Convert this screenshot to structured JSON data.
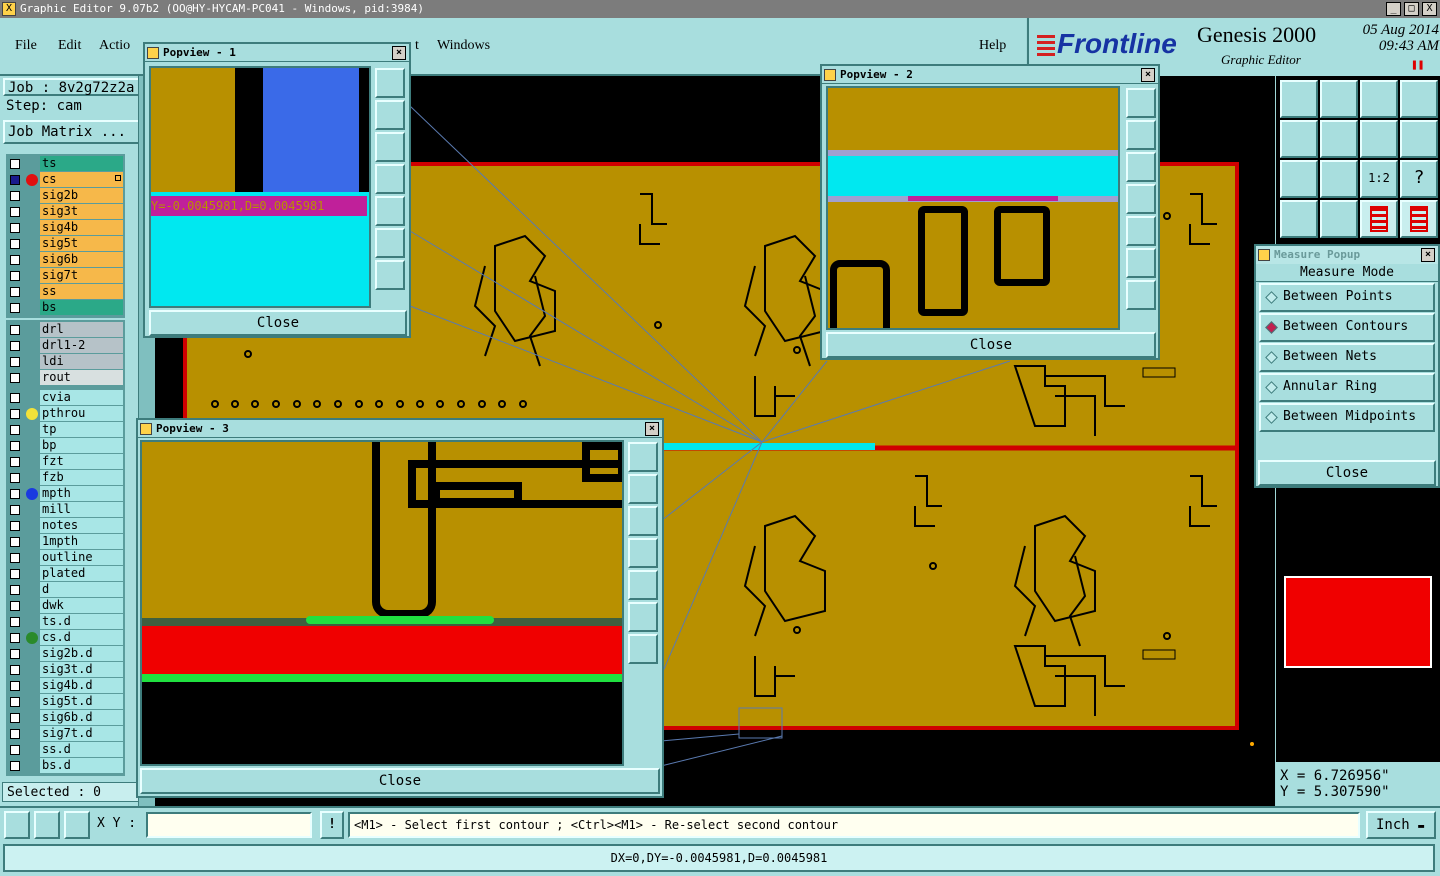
{
  "window": {
    "title": "Graphic Editor 9.07b2 (OO@HY-HYCAM-PC041 - Windows, pid:3984)",
    "controls": [
      "_",
      "□",
      "X"
    ]
  },
  "menu": {
    "file": "File",
    "edit": "Edit",
    "action": "Actio",
    "hidden_tail": "t",
    "windows": "Windows",
    "help": "Help"
  },
  "brand": {
    "logo": "Frontline",
    "product": "Genesis 2000",
    "subtitle": "Graphic Editor",
    "date": "05 Aug 2014",
    "time": "09:43 AM"
  },
  "job": {
    "job_label": "Job : 8v2g72z2a",
    "step_label": "Step: cam",
    "matrix_button": "Job Matrix ..."
  },
  "layers_group1": [
    {
      "name": "ts",
      "color": "teal",
      "dot": ""
    },
    {
      "name": "cs",
      "color": "orange",
      "dot": "#e01010",
      "active": true
    },
    {
      "name": "sig2b",
      "color": "orange",
      "dot": ""
    },
    {
      "name": "sig3t",
      "color": "orange",
      "dot": ""
    },
    {
      "name": "sig4b",
      "color": "orange",
      "dot": ""
    },
    {
      "name": "sig5t",
      "color": "orange",
      "dot": ""
    },
    {
      "name": "sig6b",
      "color": "orange",
      "dot": ""
    },
    {
      "name": "sig7t",
      "color": "orange",
      "dot": ""
    },
    {
      "name": "ss",
      "color": "orange",
      "dot": ""
    },
    {
      "name": "bs",
      "color": "teal",
      "dot": ""
    }
  ],
  "layers_group2": [
    {
      "name": "drl",
      "color": "grey",
      "dot": ""
    },
    {
      "name": "drl1-2",
      "color": "grey",
      "dot": ""
    },
    {
      "name": "ldi",
      "color": "grey",
      "dot": ""
    },
    {
      "name": "rout",
      "color": "light",
      "dot": ""
    }
  ],
  "layers_group3": [
    {
      "name": "cvia",
      "color": "cyan",
      "dot": ""
    },
    {
      "name": "pthrou",
      "color": "cyan",
      "dot": "#f2e23a"
    },
    {
      "name": "tp",
      "color": "cyan",
      "dot": ""
    },
    {
      "name": "bp",
      "color": "cyan",
      "dot": ""
    },
    {
      "name": "fzt",
      "color": "cyan",
      "dot": ""
    },
    {
      "name": "fzb",
      "color": "cyan",
      "dot": ""
    },
    {
      "name": "mpth",
      "color": "cyan",
      "dot": "#1a3ae0"
    },
    {
      "name": "mill",
      "color": "cyan",
      "dot": ""
    },
    {
      "name": "notes",
      "color": "cyan",
      "dot": ""
    },
    {
      "name": "1mpth",
      "color": "cyan",
      "dot": ""
    },
    {
      "name": "outline",
      "color": "cyan",
      "dot": ""
    },
    {
      "name": "plated",
      "color": "cyan",
      "dot": ""
    },
    {
      "name": "d",
      "color": "cyan",
      "dot": ""
    },
    {
      "name": "dwk",
      "color": "cyan",
      "dot": ""
    },
    {
      "name": "ts.d",
      "color": "cyan",
      "dot": ""
    },
    {
      "name": "cs.d",
      "color": "cyan",
      "dot": "#2a8a2a"
    },
    {
      "name": "sig2b.d",
      "color": "cyan",
      "dot": ""
    },
    {
      "name": "sig3t.d",
      "color": "cyan",
      "dot": ""
    },
    {
      "name": "sig4b.d",
      "color": "cyan",
      "dot": ""
    },
    {
      "name": "sig5t.d",
      "color": "cyan",
      "dot": ""
    },
    {
      "name": "sig6b.d",
      "color": "cyan",
      "dot": ""
    },
    {
      "name": "sig7t.d",
      "color": "cyan",
      "dot": ""
    },
    {
      "name": "ss.d",
      "color": "cyan",
      "dot": ""
    },
    {
      "name": "bs.d",
      "color": "cyan",
      "dot": ""
    }
  ],
  "selected": "Selected : 0",
  "popview1": {
    "title": "Popview - 1",
    "readout": "Y=-0.0045981,D=0.0045981",
    "close": "Close"
  },
  "popview2": {
    "title": "Popview - 2",
    "close": "Close"
  },
  "popview3": {
    "title": "Popview - 3",
    "close": "Close"
  },
  "measure": {
    "title": "Measure Popup",
    "mode_label": "Measure Mode",
    "options": [
      {
        "label": "Between Points",
        "selected": false
      },
      {
        "label": "Between Contours",
        "selected": true
      },
      {
        "label": "Between Nets",
        "selected": false
      },
      {
        "label": "Annular Ring",
        "selected": false
      },
      {
        "label": "Between Midpoints",
        "selected": false
      }
    ],
    "close": "Close"
  },
  "coords": {
    "x": "X = 6.726956\"",
    "y": "Y = 5.307590\""
  },
  "bottom": {
    "xy_label": "X Y :",
    "xy_value": "",
    "message": "<M1> - Select first contour ; <Ctrl><M1> - Re-select second contour",
    "units": "Inch",
    "tool_icons": [
      "snap-icon",
      "measure-icon",
      "grid-icon"
    ]
  },
  "status": "DX=0,DY=-0.0045981,D=0.0045981",
  "tools": [
    "zoom-home-icon",
    "zoom-in-icon",
    "home-icon",
    "split-view-icon",
    "pan-left-icon",
    "pan-right-icon",
    "rotate-icon",
    "mirror-icon",
    "fit-icon",
    "center-icon",
    "scale-1-2-icon",
    "help-icon",
    "settings-icon",
    "grid-icon",
    "layer-red-icon",
    "layer-red-2-icon"
  ],
  "colors": {
    "bg": "#a8dede",
    "copper": "#b89000",
    "board_edge": "#d00000",
    "highlight": "#00e8f0"
  }
}
